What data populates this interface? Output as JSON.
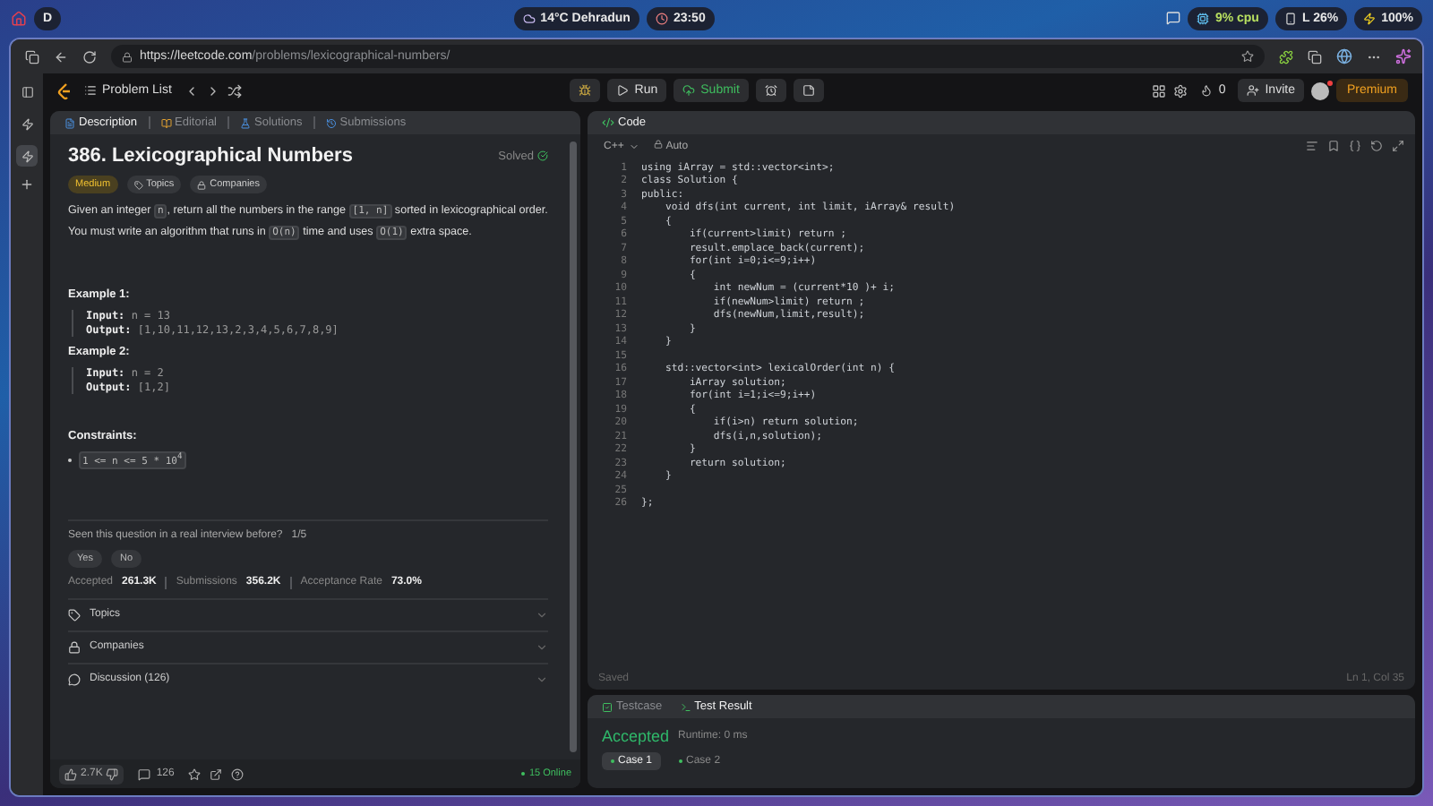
{
  "desktop_bar": {
    "workspace": "D",
    "weather": "14°C Dehradun",
    "clock": "23:50",
    "cpu": "9% cpu",
    "memory": "L 26%",
    "battery": "100%"
  },
  "browser": {
    "url_host": "https://leetcode.com",
    "url_path": "/problems/lexicographical-numbers/"
  },
  "nav": {
    "problem_list": "Problem List",
    "run": "Run",
    "submit": "Submit",
    "streak": "0",
    "invite": "Invite",
    "premium": "Premium"
  },
  "description_tabs": [
    {
      "label": "Description",
      "selected": true
    },
    {
      "label": "Editorial",
      "selected": false
    },
    {
      "label": "Solutions",
      "selected": false
    },
    {
      "label": "Submissions",
      "selected": false
    }
  ],
  "problem": {
    "title": "386. Lexicographical Numbers",
    "status": "Solved",
    "difficulty": "Medium",
    "tags": [
      "Topics",
      "Companies"
    ],
    "paragraphs": [
      [
        {
          "kind": "text",
          "text": "Given an integer "
        },
        {
          "kind": "code",
          "text": "n"
        },
        {
          "kind": "text",
          "text": ", return all the numbers in the range "
        },
        {
          "kind": "code",
          "text": "[1, n]"
        },
        {
          "kind": "text",
          "text": " sorted in lexicographical order."
        }
      ],
      [
        {
          "kind": "text",
          "text": "You must write an algorithm that runs in "
        },
        {
          "kind": "code",
          "text": "O(n)"
        },
        {
          "kind": "text",
          "text": " time and uses "
        },
        {
          "kind": "code",
          "text": "O(1)"
        },
        {
          "kind": "text",
          "text": " extra space."
        }
      ]
    ],
    "examples": [
      {
        "heading": "Example 1:",
        "lines": [
          {
            "label": "Input:",
            "value": "n = 13"
          },
          {
            "label": "Output:",
            "value": "[1,10,11,12,13,2,3,4,5,6,7,8,9]"
          }
        ]
      },
      {
        "heading": "Example 2:",
        "lines": [
          {
            "label": "Input:",
            "value": "n = 2"
          },
          {
            "label": "Output:",
            "value": "[1,2]"
          }
        ]
      }
    ],
    "constraints_heading": "Constraints:",
    "constraints": [
      "1 <= n <= 5 * 10$^{4}$"
    ],
    "interview": {
      "question": "Seen this question in a real interview before?",
      "count": "1/5",
      "answers": [
        {
          "label": "Yes",
          "selected": false
        },
        {
          "label": "No",
          "selected": false
        }
      ]
    },
    "stats": [
      {
        "label": "Accepted",
        "value": "261.3K"
      },
      {
        "label": "Submissions",
        "value": "356.2K"
      },
      {
        "label": "Acceptance Rate",
        "value": "73.0%"
      }
    ],
    "sections": [
      {
        "label": "Topics",
        "expanded": false
      },
      {
        "label": "Companies",
        "expanded": false
      },
      {
        "label": "Discussion (126)",
        "expanded": false
      }
    ],
    "footer": {
      "likes": "2.7K",
      "comments": "126",
      "online": "15 Online"
    }
  },
  "editor": {
    "title": "Code",
    "language": "C++",
    "mode": "Auto",
    "saved": "Saved",
    "cursor": "Ln 1, Col 35",
    "lines": [
      {
        "n": "1",
        "code": "using iArray = std::vector<int>;"
      },
      {
        "n": "2",
        "code": "class Solution {"
      },
      {
        "n": "3",
        "code": "public:"
      },
      {
        "n": "4",
        "code": "    void dfs(int current, int limit, iArray& result)"
      },
      {
        "n": "5",
        "code": "    {"
      },
      {
        "n": "6",
        "code": "        if(current>limit) return ;"
      },
      {
        "n": "7",
        "code": "        result.emplace_back(current);"
      },
      {
        "n": "8",
        "code": "        for(int i=0;i<=9;i++)"
      },
      {
        "n": "9",
        "code": "        {"
      },
      {
        "n": "10",
        "code": "            int newNum = (current*10 )+ i;"
      },
      {
        "n": "11",
        "code": "            if(newNum>limit) return ;"
      },
      {
        "n": "12",
        "code": "            dfs(newNum,limit,result);"
      },
      {
        "n": "13",
        "code": "        }"
      },
      {
        "n": "14",
        "code": "    }"
      },
      {
        "n": "15"
      },
      {
        "n": "16",
        "code": "    std::vector<int> lexicalOrder(int n) {"
      },
      {
        "n": "17",
        "code": "        iArray solution;"
      },
      {
        "n": "18",
        "code": "        for(int i=1;i<=9;i++)"
      },
      {
        "n": "19",
        "code": "        {"
      },
      {
        "n": "20",
        "code": "            if(i>n) return solution;"
      },
      {
        "n": "21",
        "code": "            dfs(i,n,solution);"
      },
      {
        "n": "22",
        "code": "        }"
      },
      {
        "n": "23",
        "code": "        return solution;"
      },
      {
        "n": "24",
        "code": "    }"
      },
      {
        "n": "25"
      },
      {
        "n": "26",
        "code": "};"
      }
    ]
  },
  "results": {
    "tabs": [
      {
        "label": "Testcase",
        "selected": false
      },
      {
        "label": "Test Result",
        "selected": true
      }
    ],
    "verdict": "Accepted",
    "runtime": "Runtime: 0 ms",
    "cases": [
      {
        "label": "Case 1",
        "selected": true
      },
      {
        "label": "Case 2",
        "selected": false
      }
    ]
  }
}
